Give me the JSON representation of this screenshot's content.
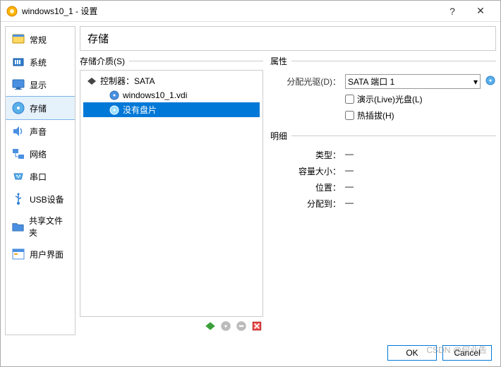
{
  "window": {
    "title": "windows10_1 - 设置"
  },
  "sidebar": {
    "items": [
      {
        "label": "常规",
        "icon": "general"
      },
      {
        "label": "系统",
        "icon": "system"
      },
      {
        "label": "显示",
        "icon": "display"
      },
      {
        "label": "存储",
        "icon": "storage"
      },
      {
        "label": "声音",
        "icon": "audio"
      },
      {
        "label": "网络",
        "icon": "network"
      },
      {
        "label": "串口",
        "icon": "serial"
      },
      {
        "label": "USB设备",
        "icon": "usb"
      },
      {
        "label": "共享文件夹",
        "icon": "shared"
      },
      {
        "label": "用户界面",
        "icon": "ui"
      }
    ],
    "selected_index": 3
  },
  "page": {
    "title": "存储",
    "storage_media_label": "存储介质(S)",
    "tree": {
      "controller_label": "控制器：SATA",
      "items": [
        {
          "label": "windows10_1.vdi",
          "icon": "hdd"
        },
        {
          "label": "没有盘片",
          "icon": "cd"
        }
      ],
      "selected_index": 1
    },
    "attributes": {
      "section_label": "属性",
      "drive_label": "分配光驱(D)：",
      "drive_value": "SATA 端口 1",
      "live_cd_label": "演示(Live)光盘(L)",
      "live_cd_checked": false,
      "hotplug_label": "热插拔(H)",
      "hotplug_checked": false
    },
    "details": {
      "section_label": "明细",
      "rows": [
        {
          "label": "类型：",
          "value": "—"
        },
        {
          "label": "容量大小：",
          "value": "—"
        },
        {
          "label": "位置：",
          "value": "—"
        },
        {
          "label": "分配到：",
          "value": "—"
        }
      ]
    }
  },
  "buttons": {
    "ok": "OK",
    "cancel": "Cancel"
  },
  "watermark": "CSDN @何业告"
}
